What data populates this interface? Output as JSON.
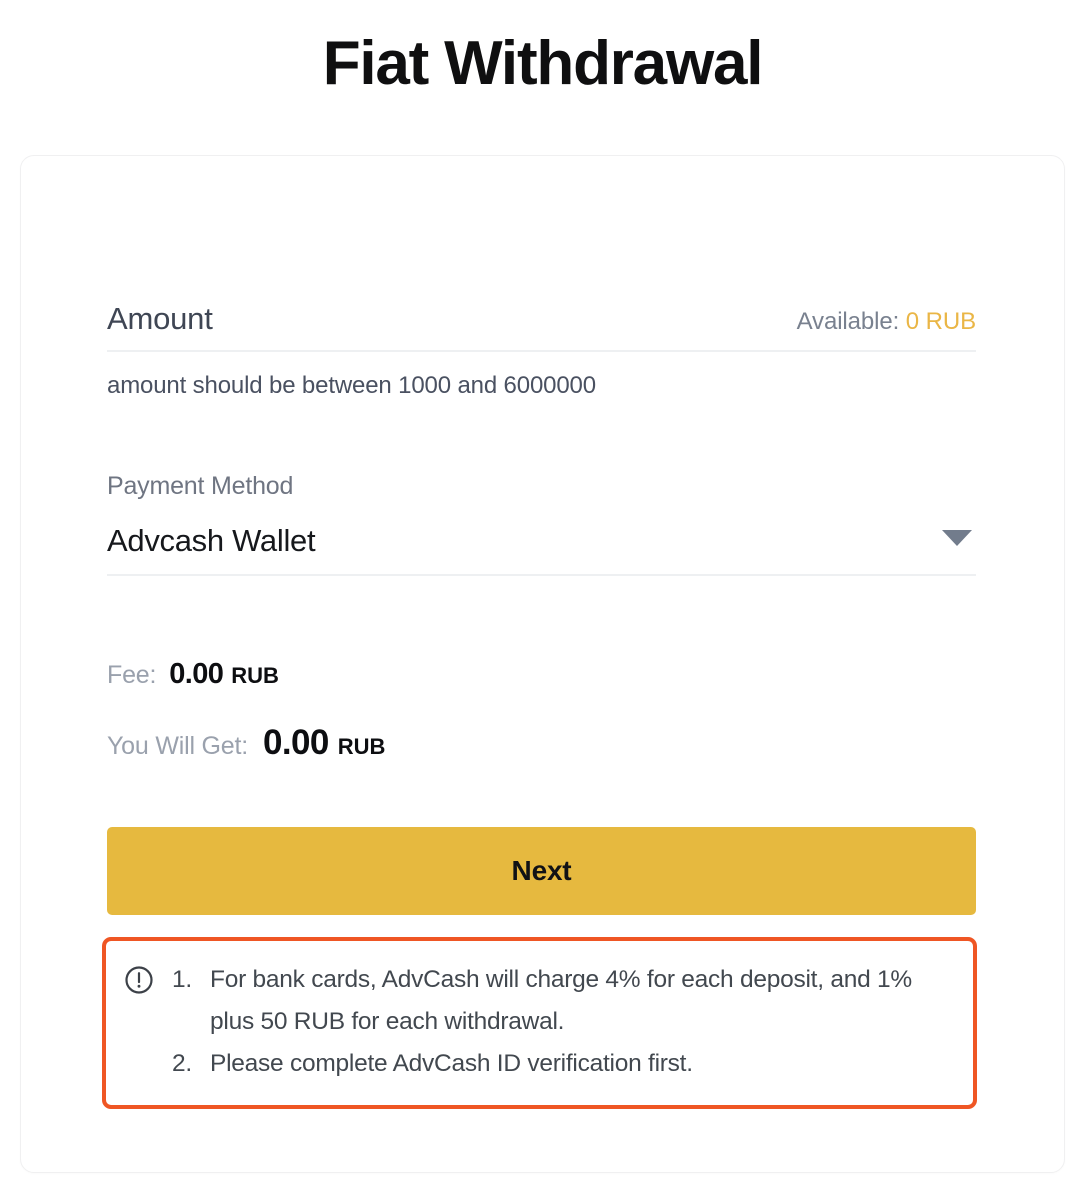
{
  "page": {
    "title": "Fiat Withdrawal"
  },
  "form": {
    "amount": {
      "label": "Amount",
      "placeholder": "Amount",
      "value": "",
      "available_label": "Available:",
      "available_value": "0 RUB",
      "helper_text": "amount should be between 1000 and 6000000"
    },
    "payment_method": {
      "label": "Payment Method",
      "selected": "Advcash Wallet",
      "chevron_icon": "chevron-down-icon"
    },
    "fee": {
      "label": "Fee:",
      "amount": "0.00",
      "currency": "RUB"
    },
    "you_will_get": {
      "label": "You Will Get:",
      "amount": "0.00",
      "currency": "RUB"
    },
    "submit": {
      "label": "Next"
    }
  },
  "warning": {
    "icon": "exclamation-circle-icon",
    "items": [
      "For bank cards, AdvCash will charge 4% for each deposit, and 1% plus 50 RUB for each withdrawal.",
      "Please complete AdvCash ID verification first."
    ]
  },
  "colors": {
    "accent_gold": "#e6b93f",
    "available_gold": "#eab646",
    "warning_border": "#ef5624",
    "muted_text": "#79818f",
    "chevron": "#727c8c"
  }
}
